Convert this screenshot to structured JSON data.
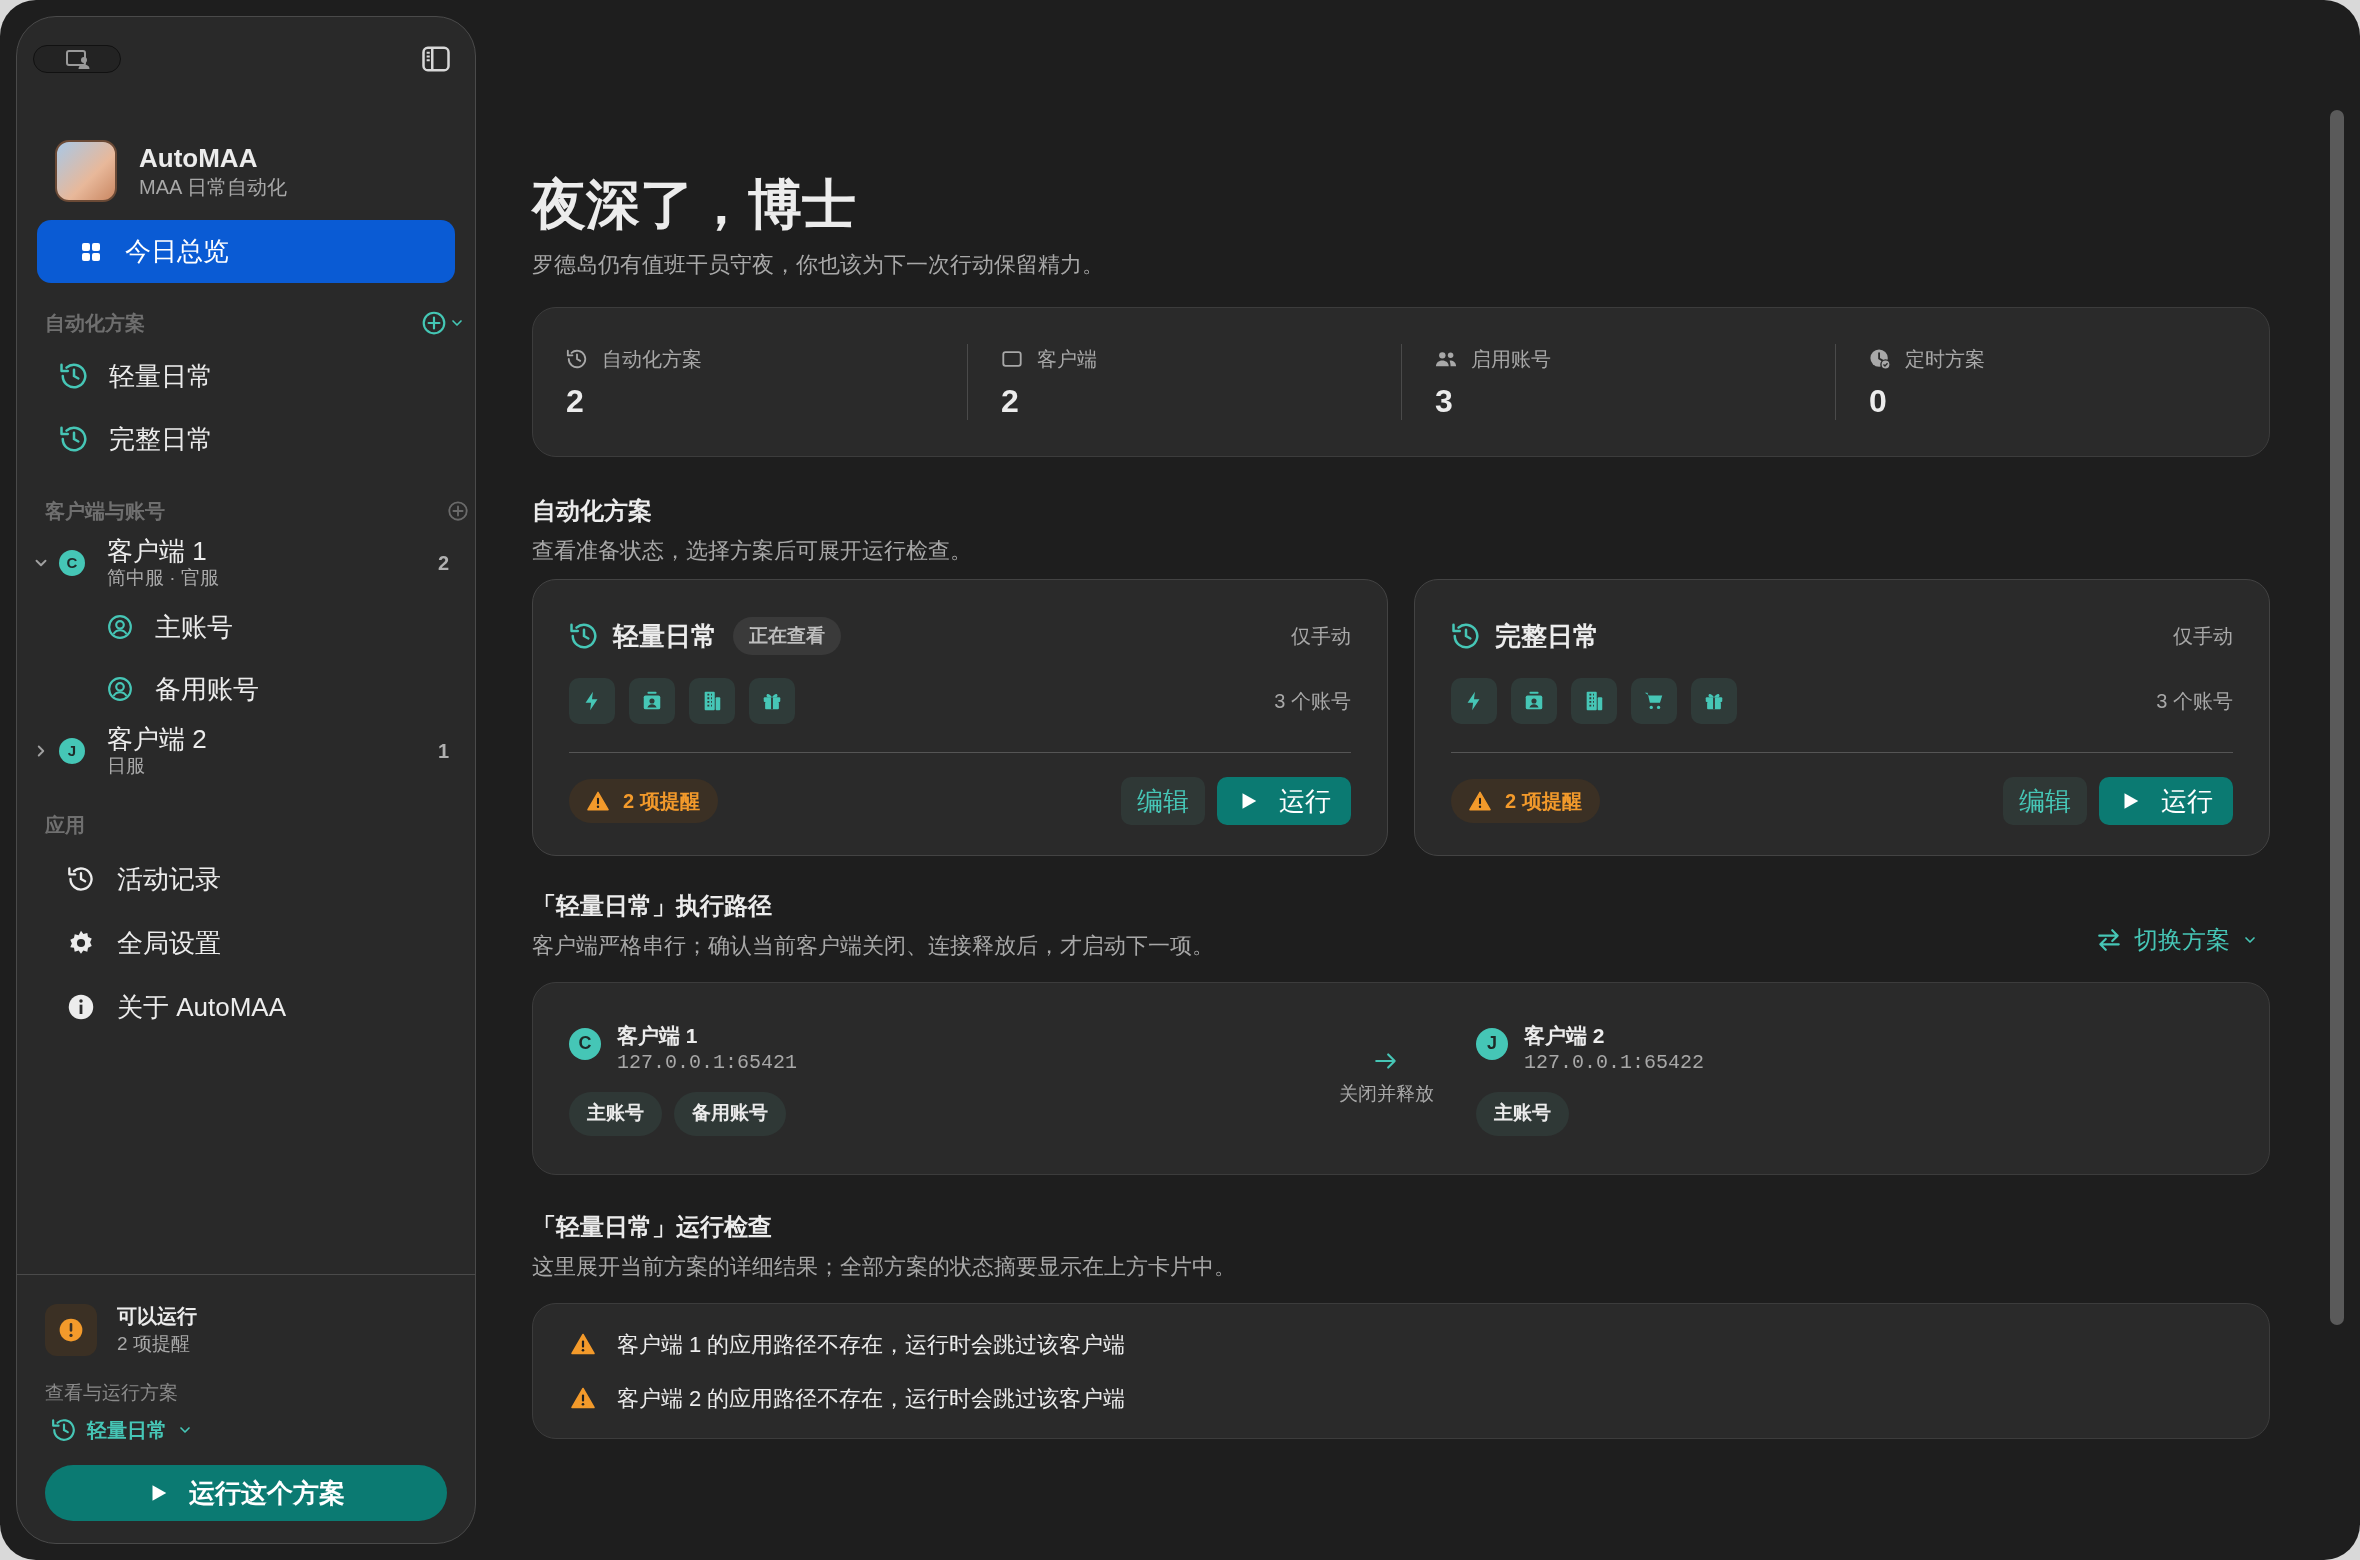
{
  "sidebar": {
    "app_name": "AutoMAA",
    "app_subtitle": "MAA 日常自动化",
    "overview": {
      "label": "今日总览",
      "selected": true
    },
    "plans_section": {
      "title": "自动化方案",
      "items": [
        {
          "label": "轻量日常",
          "selected": false
        },
        {
          "label": "完整日常",
          "selected": false
        }
      ]
    },
    "clients_section": {
      "title": "客户端与账号",
      "clients": [
        {
          "label": "客户端 1",
          "badge": "C",
          "detail": "简中服 · 官服",
          "count": "2",
          "expanded": true,
          "selected": false,
          "children": [
            {
              "label": "主账号",
              "selected": false
            },
            {
              "label": "备用账号",
              "selected": false
            }
          ]
        },
        {
          "label": "客户端 2",
          "badge": "J",
          "detail": "日服",
          "count": "1",
          "expanded": false,
          "selected": false
        }
      ]
    },
    "app_section": {
      "title": "应用",
      "items": [
        {
          "label": "活动记录",
          "kind": "history",
          "selected": false
        },
        {
          "label": "全局设置",
          "kind": "settings",
          "selected": false
        },
        {
          "label": "关于 AutoMAA",
          "kind": "info",
          "selected": false
        }
      ]
    },
    "footer": {
      "status": "可以运行",
      "reminders": "2 项提醒",
      "picker_label": "查看与运行方案",
      "selected_plan": "轻量日常",
      "run_button": "运行这个方案"
    }
  },
  "main": {
    "greeting": "夜深了，博士",
    "subtitle": "罗德岛仍有值班干员守夜，你也该为下一次行动保留精力。",
    "stats": [
      {
        "kind": "plans",
        "label": "自动化方案",
        "value": "2"
      },
      {
        "kind": "clients",
        "label": "客户端",
        "value": "2"
      },
      {
        "kind": "accounts",
        "label": "启用账号",
        "value": "3"
      },
      {
        "kind": "schedules",
        "label": "定时方案",
        "value": "0"
      }
    ],
    "plans": {
      "title": "自动化方案",
      "subtitle": "查看准备状态，选择方案后可展开运行检查。",
      "cards": [
        {
          "name": "轻量日常",
          "tag": "正在查看",
          "mode": "仅手动",
          "tasks": [
            {
              "kind": "combat"
            },
            {
              "kind": "recruit"
            },
            {
              "kind": "base"
            },
            {
              "kind": "reward"
            }
          ],
          "accounts": "3 个账号",
          "warnings": "2 项提醒",
          "edit": "编辑",
          "run": "运行"
        },
        {
          "name": "完整日常",
          "mode": "仅手动",
          "tasks": [
            {
              "kind": "combat"
            },
            {
              "kind": "recruit"
            },
            {
              "kind": "base"
            },
            {
              "kind": "shop"
            },
            {
              "kind": "reward"
            }
          ],
          "accounts": "3 个账号",
          "warnings": "2 项提醒",
          "edit": "编辑",
          "run": "运行"
        }
      ]
    },
    "path": {
      "title": "「轻量日常」执行路径",
      "subtitle": "客户端严格串行；确认当前客户端关闭、连接释放后，才启动下一项。",
      "switch_label": "切换方案",
      "connector_label": "关闭并释放",
      "clients": [
        {
          "badge": "C",
          "name": "客户端 1",
          "address": "127.0.0.1:65421",
          "accounts": [
            "主账号",
            "备用账号"
          ]
        },
        {
          "badge": "J",
          "name": "客户端 2",
          "address": "127.0.0.1:65422",
          "accounts": [
            "主账号"
          ]
        }
      ]
    },
    "check": {
      "title": "「轻量日常」运行检查",
      "subtitle": "这里展开当前方案的详细结果；全部方案的状态摘要显示在上方卡片中。",
      "warnings": [
        "客户端 1 的应用路径不存在，运行时会跳过该客户端",
        "客户端 2 的应用路径不存在，运行时会跳过该客户端"
      ]
    }
  }
}
